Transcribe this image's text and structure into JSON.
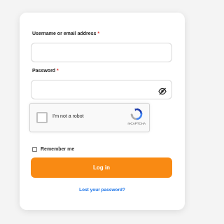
{
  "form": {
    "username_label": "Username or email address",
    "password_label": "Password",
    "required_mark": "*",
    "username_value": "",
    "password_value": "",
    "password_toggle_icon": "eye-slash-icon"
  },
  "recaptcha": {
    "checkbox_label": "I'm not a robot",
    "brand_text": "reCAPTCHA",
    "checked": false,
    "logo_icon": "recaptcha-logo-icon"
  },
  "remember": {
    "label": "Remember me",
    "checked": false
  },
  "actions": {
    "login_label": "Log in",
    "lost_password_label": "Lost your password?"
  },
  "colors": {
    "primary": "#f98a13",
    "link": "#1a73e8",
    "required": "#e53935"
  }
}
